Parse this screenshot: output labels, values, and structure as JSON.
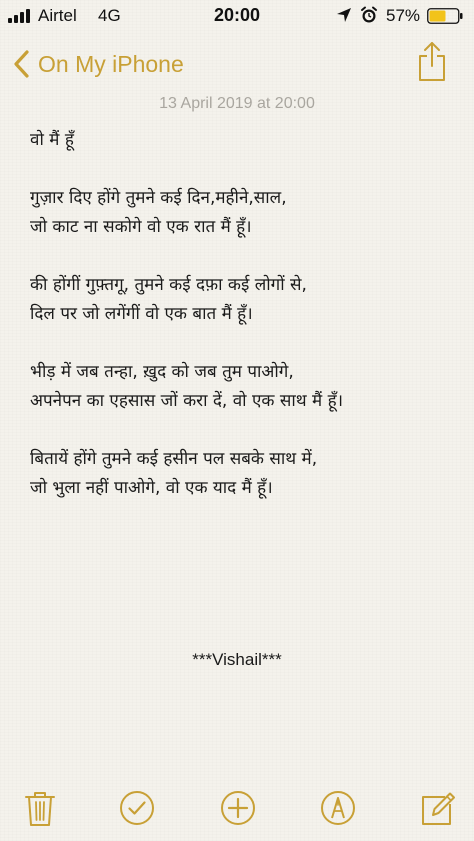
{
  "status_bar": {
    "carrier": "Airtel",
    "network": "4G",
    "time": "20:00",
    "battery_percent": "57%",
    "battery_level": 0.57,
    "icons": [
      "signal-icon",
      "location-icon",
      "alarm-icon",
      "battery-icon"
    ]
  },
  "nav": {
    "back_label": "On My iPhone",
    "back_icon": "chevron-left-icon",
    "share_icon": "share-icon"
  },
  "note": {
    "date": "13 April 2019 at 20:00",
    "title_line": "वो मैं हूँ",
    "stanzas": [
      [
        "गुज़ार दिए होंगे तुमने कई दिन,महीने,साल,",
        "जो काट ना सकोगे वो एक रात मैं हूँ।"
      ],
      [
        "की होंगीं गुफ़्तगू, तुमने कई दफ़ा कई लोगों से,",
        "दिल पर जो लगेंगीं वो एक बात मैं हूँ।"
      ],
      [
        "भीड़ में जब तन्हा, ख़ुद को जब तुम पाओगे,",
        "अपनेपन का एहसास जों करा दें, वो एक साथ मैं हूँ।"
      ],
      [
        "बितायें होंगे तुमने कई हसीन पल सबके साथ में,",
        "जो भुला नहीं पाओगे, वो एक याद मैं हूँ।"
      ]
    ],
    "signature": "***Vishail***"
  },
  "toolbar": {
    "icons": [
      "trash-icon",
      "checklist-icon",
      "add-icon",
      "markup-icon",
      "compose-icon"
    ]
  },
  "colors": {
    "accent": "#c8a036",
    "background": "#f4f2ec",
    "date_text": "#a9a69f",
    "body_text": "#1a1a1a"
  }
}
